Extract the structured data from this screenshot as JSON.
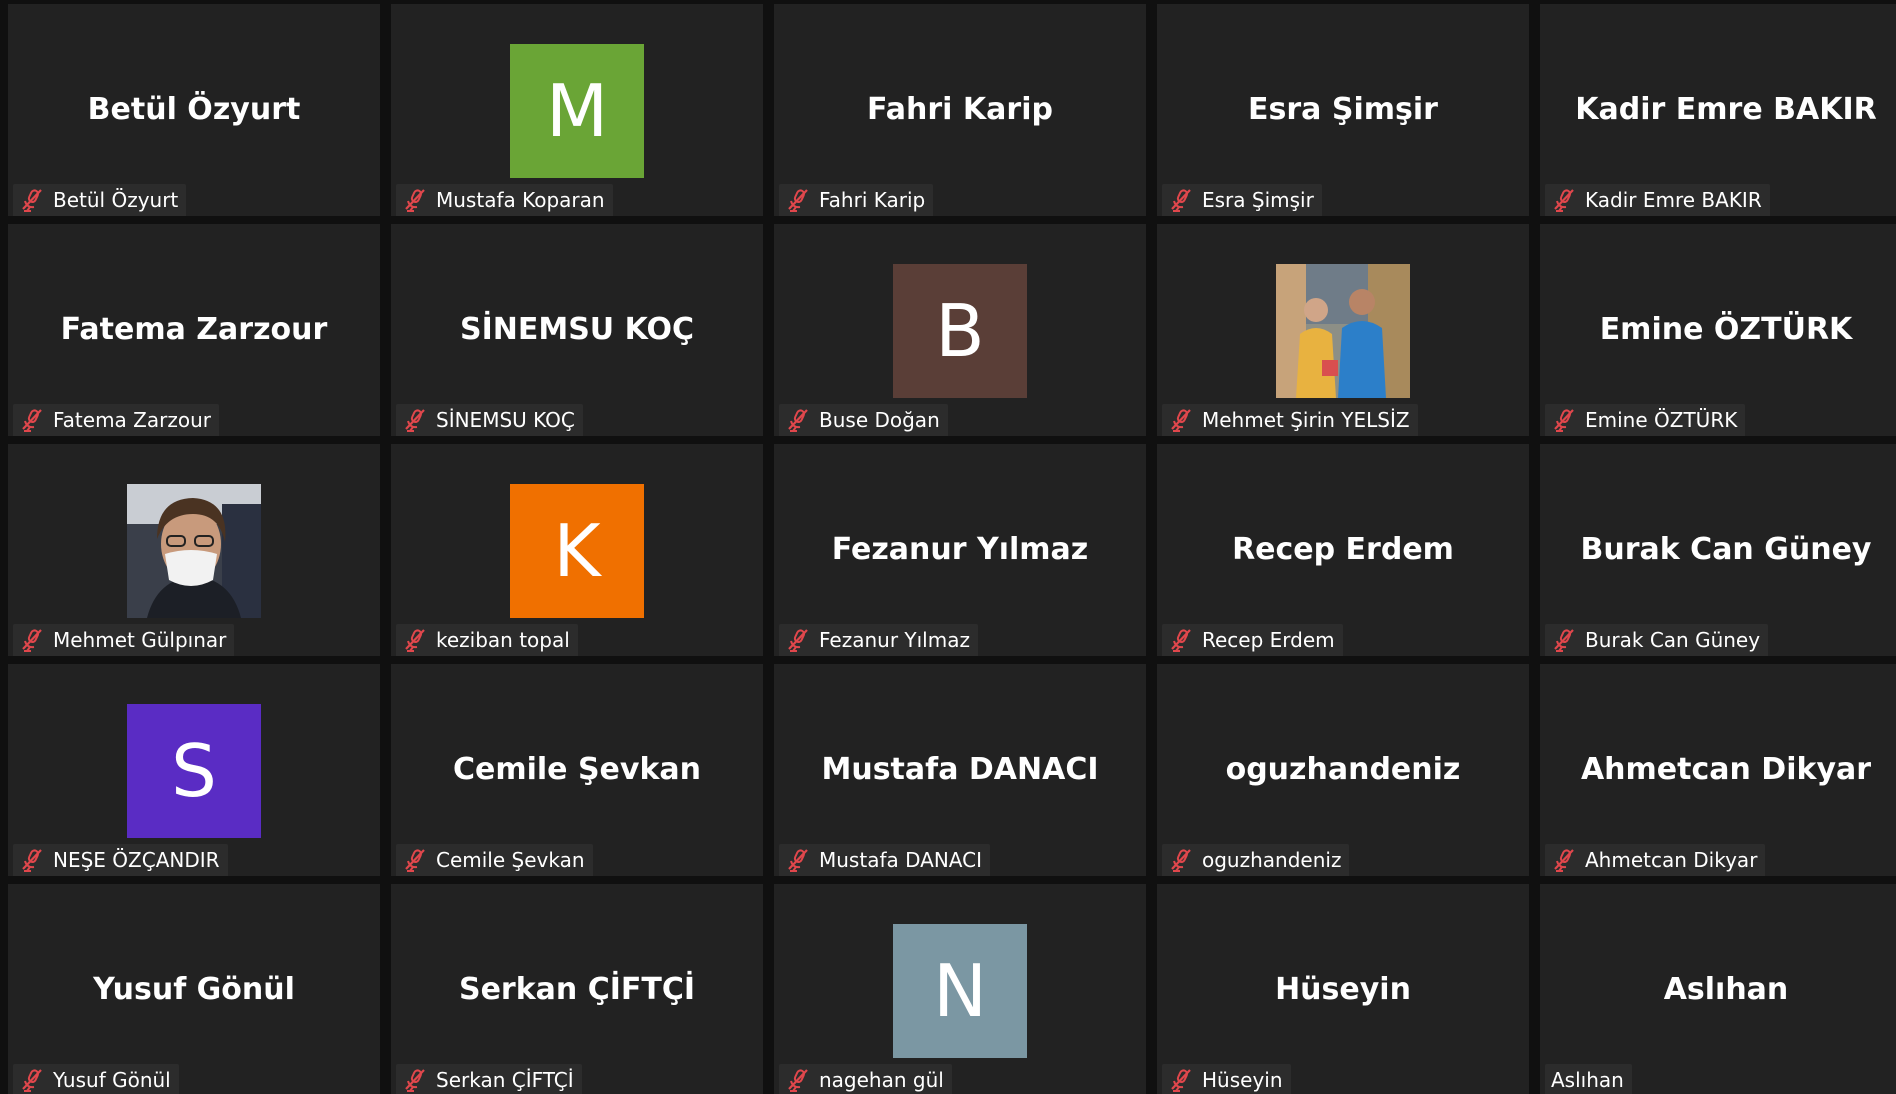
{
  "participants": [
    {
      "display": "Betül Özyurt",
      "label": "Betül Özyurt",
      "muted": true
    },
    {
      "display": "",
      "label": "Mustafa Koparan",
      "muted": true,
      "avatar": {
        "letter": "M",
        "color": "#6aa536"
      }
    },
    {
      "display": "Fahri Karip",
      "label": "Fahri Karip",
      "muted": true
    },
    {
      "display": "Esra Şimşir",
      "label": "Esra Şimşir",
      "muted": true
    },
    {
      "display": "Kadir Emre BAKIR",
      "label": "Kadir Emre BAKIR",
      "muted": true
    },
    {
      "display": "Fatema Zarzour",
      "label": "Fatema Zarzour",
      "muted": true
    },
    {
      "display": "SİNEMSU KOÇ",
      "label": "SİNEMSU KOÇ",
      "muted": true
    },
    {
      "display": "",
      "label": "Buse Doğan",
      "muted": true,
      "avatar": {
        "letter": "B",
        "color": "#5a3e37"
      }
    },
    {
      "display": "",
      "label": "Mehmet Şirin YELSİZ",
      "muted": true,
      "avatar": {
        "photo": "two-men-outdoor-photo"
      }
    },
    {
      "display": "Emine ÖZTÜRK",
      "label": "Emine ÖZTÜRK",
      "muted": true
    },
    {
      "display": "",
      "label": "Mehmet Gülpınar",
      "muted": true,
      "avatar": {
        "photo": "man-with-mask-photo"
      }
    },
    {
      "display": "",
      "label": "keziban topal",
      "muted": true,
      "avatar": {
        "letter": "K",
        "color": "#f07000"
      }
    },
    {
      "display": "Fezanur Yılmaz",
      "label": "Fezanur Yılmaz",
      "muted": true
    },
    {
      "display": "Recep Erdem",
      "label": "Recep Erdem",
      "muted": true
    },
    {
      "display": "Burak Can Güney",
      "label": "Burak Can Güney",
      "muted": true
    },
    {
      "display": "",
      "label": "NEŞE ÖZÇANDIR",
      "muted": true,
      "avatar": {
        "letter": "S",
        "color": "#5a2cc4"
      }
    },
    {
      "display": "Cemile Şevkan",
      "label": "Cemile Şevkan",
      "muted": true
    },
    {
      "display": "Mustafa DANACI",
      "label": "Mustafa DANACI",
      "muted": true
    },
    {
      "display": "oguzhandeniz",
      "label": "oguzhandeniz",
      "muted": true
    },
    {
      "display": "Ahmetcan Dikyar",
      "label": "Ahmetcan Dikyar",
      "muted": true
    },
    {
      "display": "Yusuf Gönül",
      "label": "Yusuf Gönül",
      "muted": true
    },
    {
      "display": "Serkan ÇİFTÇİ",
      "label": "Serkan ÇİFTÇİ",
      "muted": true
    },
    {
      "display": "",
      "label": "nagehan gül",
      "muted": true,
      "avatar": {
        "letter": "N",
        "color": "#7b97a3"
      }
    },
    {
      "display": "Hüseyin",
      "label": "Hüseyin",
      "muted": true
    },
    {
      "display": "Aslıhan",
      "label": "Aslıhan",
      "muted": false
    }
  ],
  "colors": {
    "tile_background": "#222222",
    "gallery_background": "#101010",
    "name_bar": "#2c2c2c",
    "mute_icon": "#e0474c"
  }
}
